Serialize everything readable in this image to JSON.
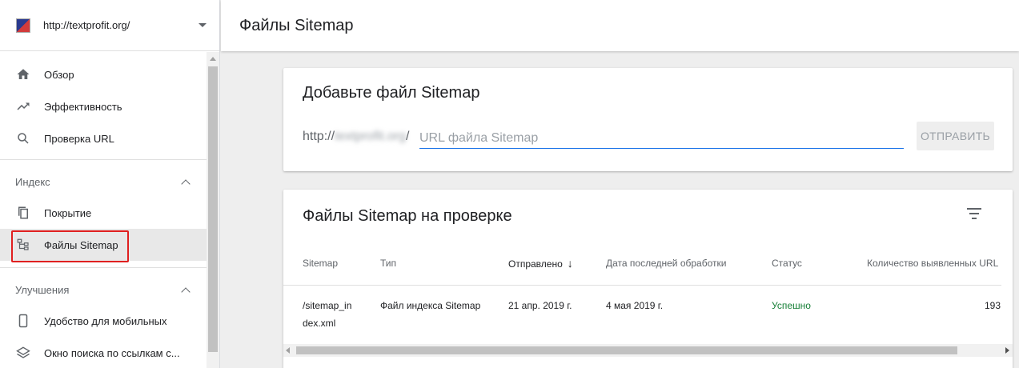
{
  "sidebar": {
    "property_url": "http://textprofit.org/",
    "top_items": [
      {
        "label": "Обзор",
        "icon": "home-icon"
      },
      {
        "label": "Эффективность",
        "icon": "trending-up-icon"
      },
      {
        "label": "Проверка URL",
        "icon": "search-icon"
      }
    ],
    "section_index": {
      "title": "Индекс",
      "items": [
        {
          "label": "Покрытие",
          "icon": "copy-pages-icon"
        },
        {
          "label": "Файлы Sitemap",
          "icon": "sitemap-tree-icon",
          "active": true
        }
      ]
    },
    "section_improvements": {
      "title": "Улучшения",
      "items": [
        {
          "label": "Удобство для мобильных",
          "icon": "smartphone-icon"
        },
        {
          "label": "Окно поиска по ссылкам с...",
          "icon": "layers-icon"
        }
      ]
    }
  },
  "header": {
    "title": "Файлы Sitemap"
  },
  "add_sitemap": {
    "title": "Добавьте файл Sitemap",
    "prefix_start": "http://",
    "prefix_host": "textprofit.org",
    "prefix_end": "/",
    "input_placeholder": "URL файла Sitemap",
    "input_value": "",
    "submit_label": "ОТПРАВИТЬ"
  },
  "submitted": {
    "title": "Файлы Sitemap на проверке",
    "columns": [
      "Sitemap",
      "Тип",
      "Отправлено",
      "Дата последней обработки",
      "Статус",
      "Количество выявленных URL"
    ],
    "sorted_column": "Отправлено",
    "sort_direction": "descending",
    "rows": [
      {
        "sitemap": "/sitemap_index.xml",
        "sitemap_line1": "/sitemap_in",
        "sitemap_line2": "dex.xml",
        "type": "Файл индекса Sitemap",
        "submitted": "21 апр. 2019 г.",
        "last_processed": "4 мая 2019 г.",
        "status": "Успешно",
        "discovered_urls": "193"
      }
    ]
  },
  "colors": {
    "accent": "#1a73e8",
    "success": "#188038",
    "highlight": "#e02020"
  }
}
